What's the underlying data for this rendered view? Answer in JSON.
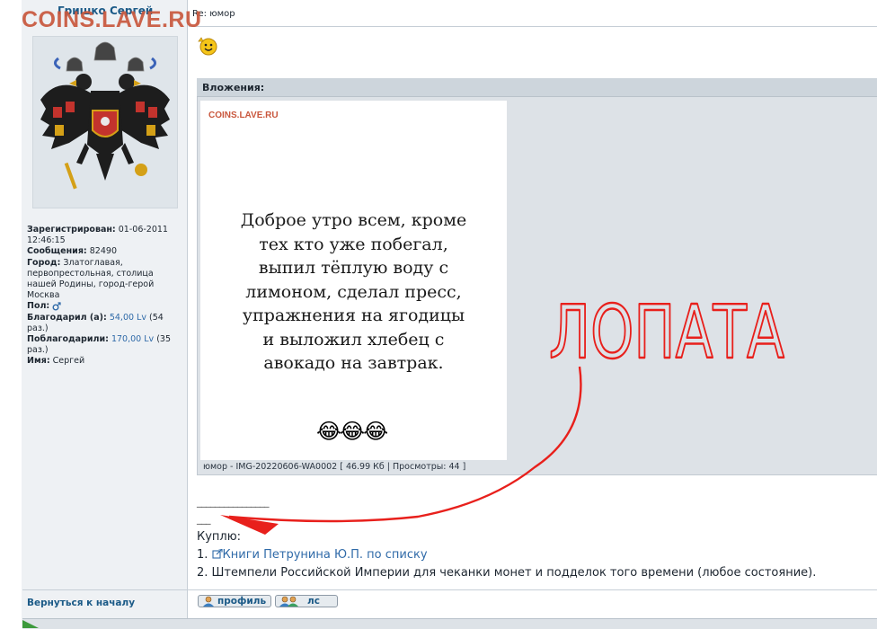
{
  "watermark": "COINS.LAVE.RU",
  "user": {
    "name": "Гришко Сергей",
    "registered_label": "Зарегистрирован:",
    "registered_value": "01-06-2011 12:46:15",
    "messages_label": "Сообщения:",
    "messages_value": "82490",
    "city_label": "Город:",
    "city_value": "Златоглавая, первопрестольная, столица нашей Родины, город-герой Москва",
    "gender_label": "Пол:",
    "thanked_label": "Благодарил (а):",
    "thanked_value": "54,00 Lv",
    "thanked_count": "(54 раз.)",
    "thanked_by_label": "Поблагодарили:",
    "thanked_by_value": "170,00 Lv",
    "thanked_by_count": "(35 раз.)",
    "name_label": "Имя:",
    "name_value": "Сергей"
  },
  "post": {
    "title": "Re: юмор",
    "attachments_label": "Вложения:",
    "image_watermark": "COINS.LAVE.RU",
    "quote": "Доброе утро всем, кроме\nтех кто уже побегал,\nвыпил тёплую воду с\nлимоном, сделал пресс,\nупражнения на ягодицы\nи выложил хлебец с\nавокадо на завтрак.",
    "emoji": "😂😂😂",
    "attachment_meta": "юмор - IMG-20220606-WA0002 [ 46.99 Кб | Просмотры: 44 ]",
    "handwriting": "ЛОПАТА"
  },
  "signature": {
    "line_long": "________________",
    "line_short": "___",
    "buy_label": "Куплю:",
    "item1_num": "1.",
    "item1_link": "Книги Петрунина Ю.П. по списку",
    "item2": "2. Штемпели Российской Империи для чеканки монет и подделок того времени (любое состояние)."
  },
  "footer": {
    "back_link": "Вернуться к началу",
    "profile_button": "профиль",
    "pm_button": "лс"
  },
  "colors": {
    "link": "#2f6aa8",
    "watermark": "#c9573d",
    "annotation": "#e8201c"
  }
}
